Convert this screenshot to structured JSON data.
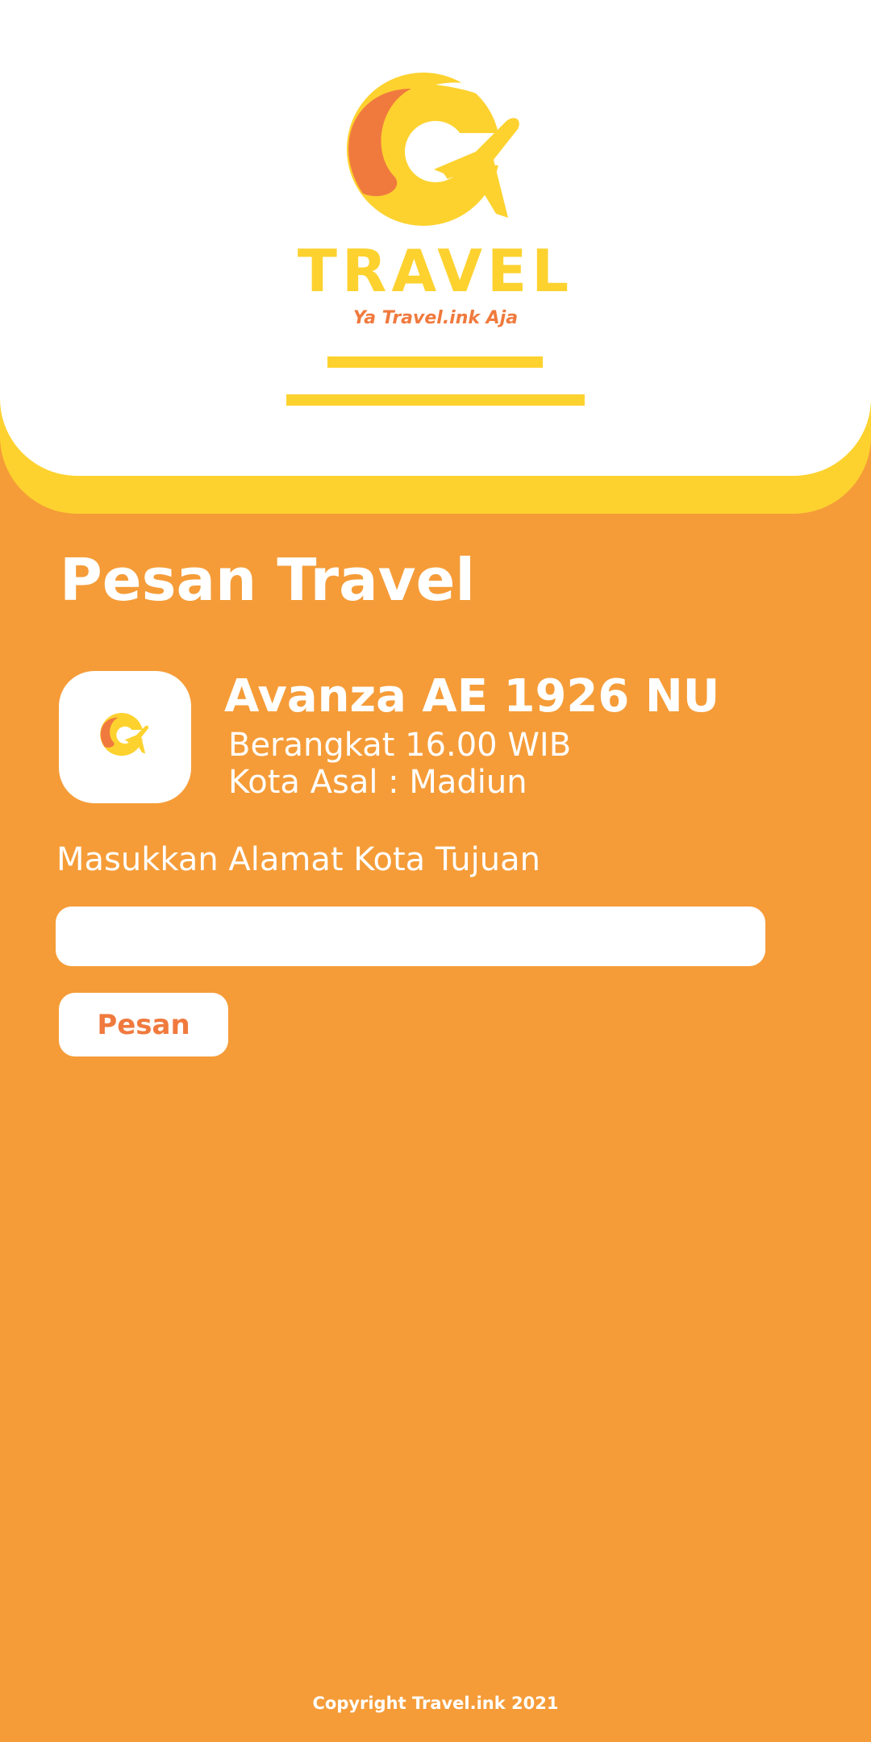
{
  "header": {
    "brand_name": "TRAVEL",
    "tagline": "Ya Travel.ink Aja"
  },
  "main": {
    "title": "Pesan Travel",
    "vehicle": {
      "name": "Avanza AE 1926 NU",
      "departure": "Berangkat 16.00 WIB",
      "origin": "Kota Asal : Madiun"
    },
    "destination_label": "Masukkan Alamat Kota Tujuan",
    "destination_value": "",
    "destination_placeholder": "",
    "submit_label": "Pesan"
  },
  "footer": {
    "copyright": "Copyright Travel.ink 2021"
  },
  "icons": {
    "logo": "travel-g-plane-logo",
    "vehicle": "travel-g-plane-logo"
  },
  "colors": {
    "background": "#f59c38",
    "accent_yellow": "#fdd22f",
    "accent_orange": "#f07a3e",
    "card": "#ffffff"
  }
}
